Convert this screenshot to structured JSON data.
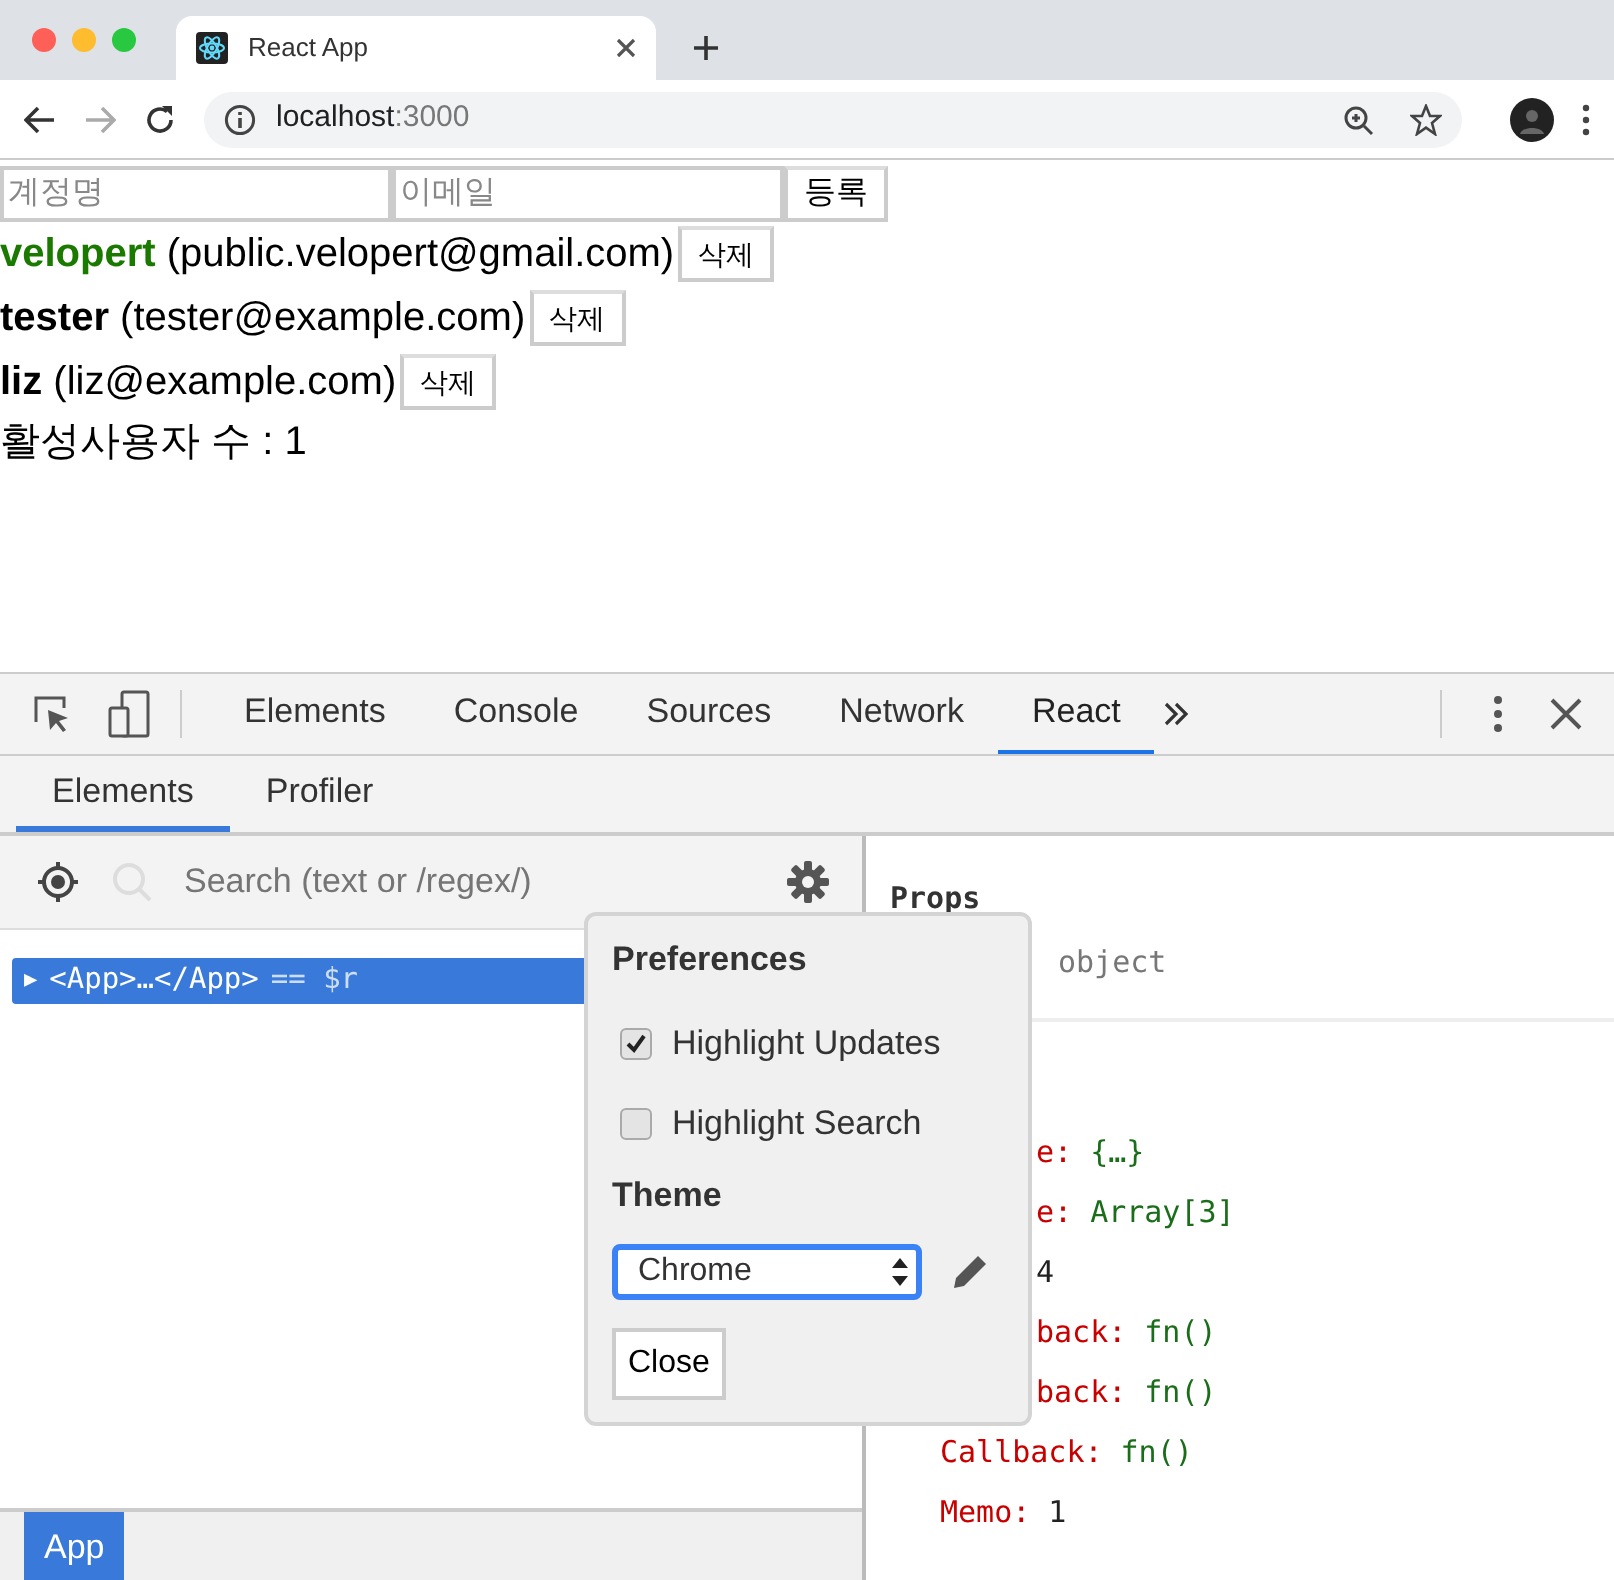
{
  "browser": {
    "tab_title": "React App",
    "url_host": "localhost",
    "url_port": ":3000"
  },
  "page": {
    "fields": [
      {
        "placeholder": "계정명"
      },
      {
        "placeholder": "이메일"
      }
    ],
    "submit": "등록",
    "users": [
      {
        "username": "velopert",
        "email": "(public.velopert@gmail.com)",
        "active": true,
        "delete": "삭제"
      },
      {
        "username": "tester",
        "email": "(tester@example.com)",
        "active": false,
        "delete": "삭제"
      },
      {
        "username": "liz",
        "email": "(liz@example.com)",
        "active": false,
        "delete": "삭제"
      }
    ],
    "active_count": "활성사용자 수 : 1"
  },
  "devtools": {
    "tabs": [
      {
        "label": "Elements",
        "selected": false
      },
      {
        "label": "Console",
        "selected": false
      },
      {
        "label": "Sources",
        "selected": false
      },
      {
        "label": "Network",
        "selected": false
      },
      {
        "label": "React",
        "selected": true
      }
    ],
    "react_tabs": [
      {
        "label": "Elements",
        "selected": true
      },
      {
        "label": "Profiler",
        "selected": false
      }
    ],
    "search": {
      "placeholder": "Search (text or /regex/)"
    },
    "tree": [
      {
        "toggle": "▶",
        "text": "<App>…</App>",
        "suffix": "== $r",
        "selected": true
      }
    ],
    "props": {
      "title": "Props",
      "note": "object",
      "rows": [
        {
          "key": "e:",
          "value": "{…}",
          "kind": "object"
        },
        {
          "key": "e:",
          "value": "Array[3]",
          "kind": "object"
        },
        {
          "value": "4",
          "kind": "number"
        },
        {
          "key": "back:",
          "value": "fn()",
          "kind": "function"
        },
        {
          "key": "back:",
          "value": "fn()",
          "kind": "function"
        },
        {
          "key": "Callback:",
          "value": "fn()",
          "kind": "function"
        },
        {
          "key": "Memo:",
          "value": "1",
          "kind": "number"
        }
      ]
    },
    "preferences": {
      "title": "Preferences",
      "options": [
        {
          "label": "Highlight Updates",
          "checked": true
        },
        {
          "label": "Highlight Search",
          "checked": false
        }
      ],
      "theme_title": "Theme",
      "theme": "Chrome",
      "close": "Close"
    },
    "breadcrumbs": [
      {
        "label": "App",
        "selected": true
      }
    ]
  }
}
